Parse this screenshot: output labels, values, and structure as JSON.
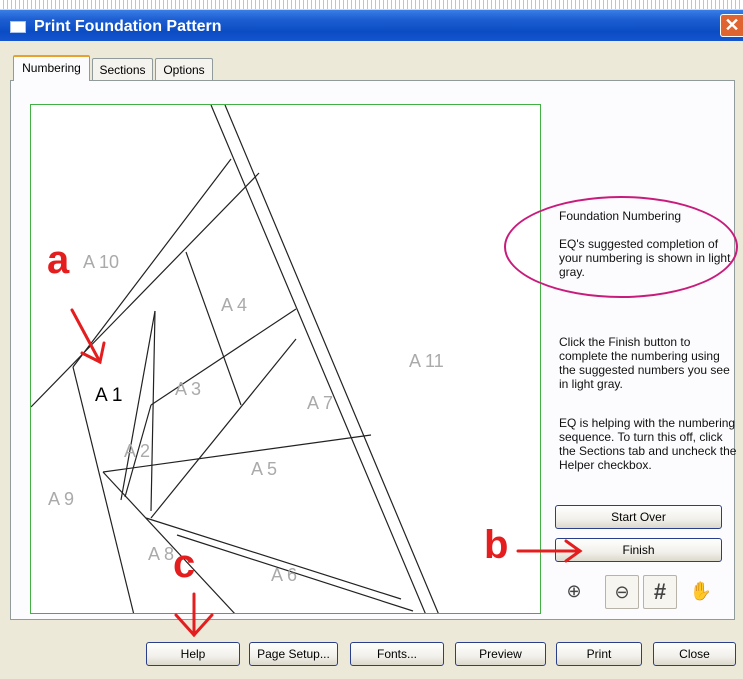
{
  "window": {
    "title": "Print Foundation Pattern",
    "close_glyph": "✕"
  },
  "tabs": [
    {
      "label": "Numbering",
      "active": true
    },
    {
      "label": "Sections",
      "active": false
    },
    {
      "label": "Options",
      "active": false
    }
  ],
  "pattern": {
    "sections": [
      {
        "label": "A 10",
        "color": "#aaaaaa"
      },
      {
        "label": "A 1",
        "color": "#000000"
      },
      {
        "label": "A 4",
        "color": "#aaaaaa"
      },
      {
        "label": "A 3",
        "color": "#aaaaaa"
      },
      {
        "label": "A 2",
        "color": "#aaaaaa"
      },
      {
        "label": "A 11",
        "color": "#aaaaaa"
      },
      {
        "label": "A 7",
        "color": "#aaaaaa"
      },
      {
        "label": "A 5",
        "color": "#aaaaaa"
      },
      {
        "label": "A 9",
        "color": "#aaaaaa"
      },
      {
        "label": "A 8",
        "color": "#aaaaaa"
      },
      {
        "label": "A 6",
        "color": "#aaaaaa"
      }
    ]
  },
  "info": {
    "heading": "Foundation Numbering",
    "suggestion": "EQ's suggested completion of your numbering is shown in light gray.",
    "finish_hint": "Click the Finish button to complete the numbering using the suggested numbers you see in light gray.",
    "helper_hint": "EQ is helping with the numbering sequence. To turn this off, click the Sections tab and uncheck the Helper checkbox."
  },
  "buttons": {
    "start_over": "Start Over",
    "finish": "Finish",
    "help": "Help",
    "page_setup": "Page Setup...",
    "fonts": "Fonts...",
    "preview": "Preview",
    "print": "Print",
    "close": "Close"
  },
  "tools": [
    {
      "icon": "zoom-in-icon",
      "glyph": "⊕"
    },
    {
      "icon": "zoom-out-icon",
      "glyph": "⊖"
    },
    {
      "icon": "grid-icon",
      "glyph": "#"
    },
    {
      "icon": "pan-hand-icon",
      "glyph": "✋"
    }
  ],
  "annotations": {
    "a": "a",
    "b": "b",
    "c": "c",
    "color": "#e41e1e",
    "ellipse_color": "#c81c7c"
  }
}
